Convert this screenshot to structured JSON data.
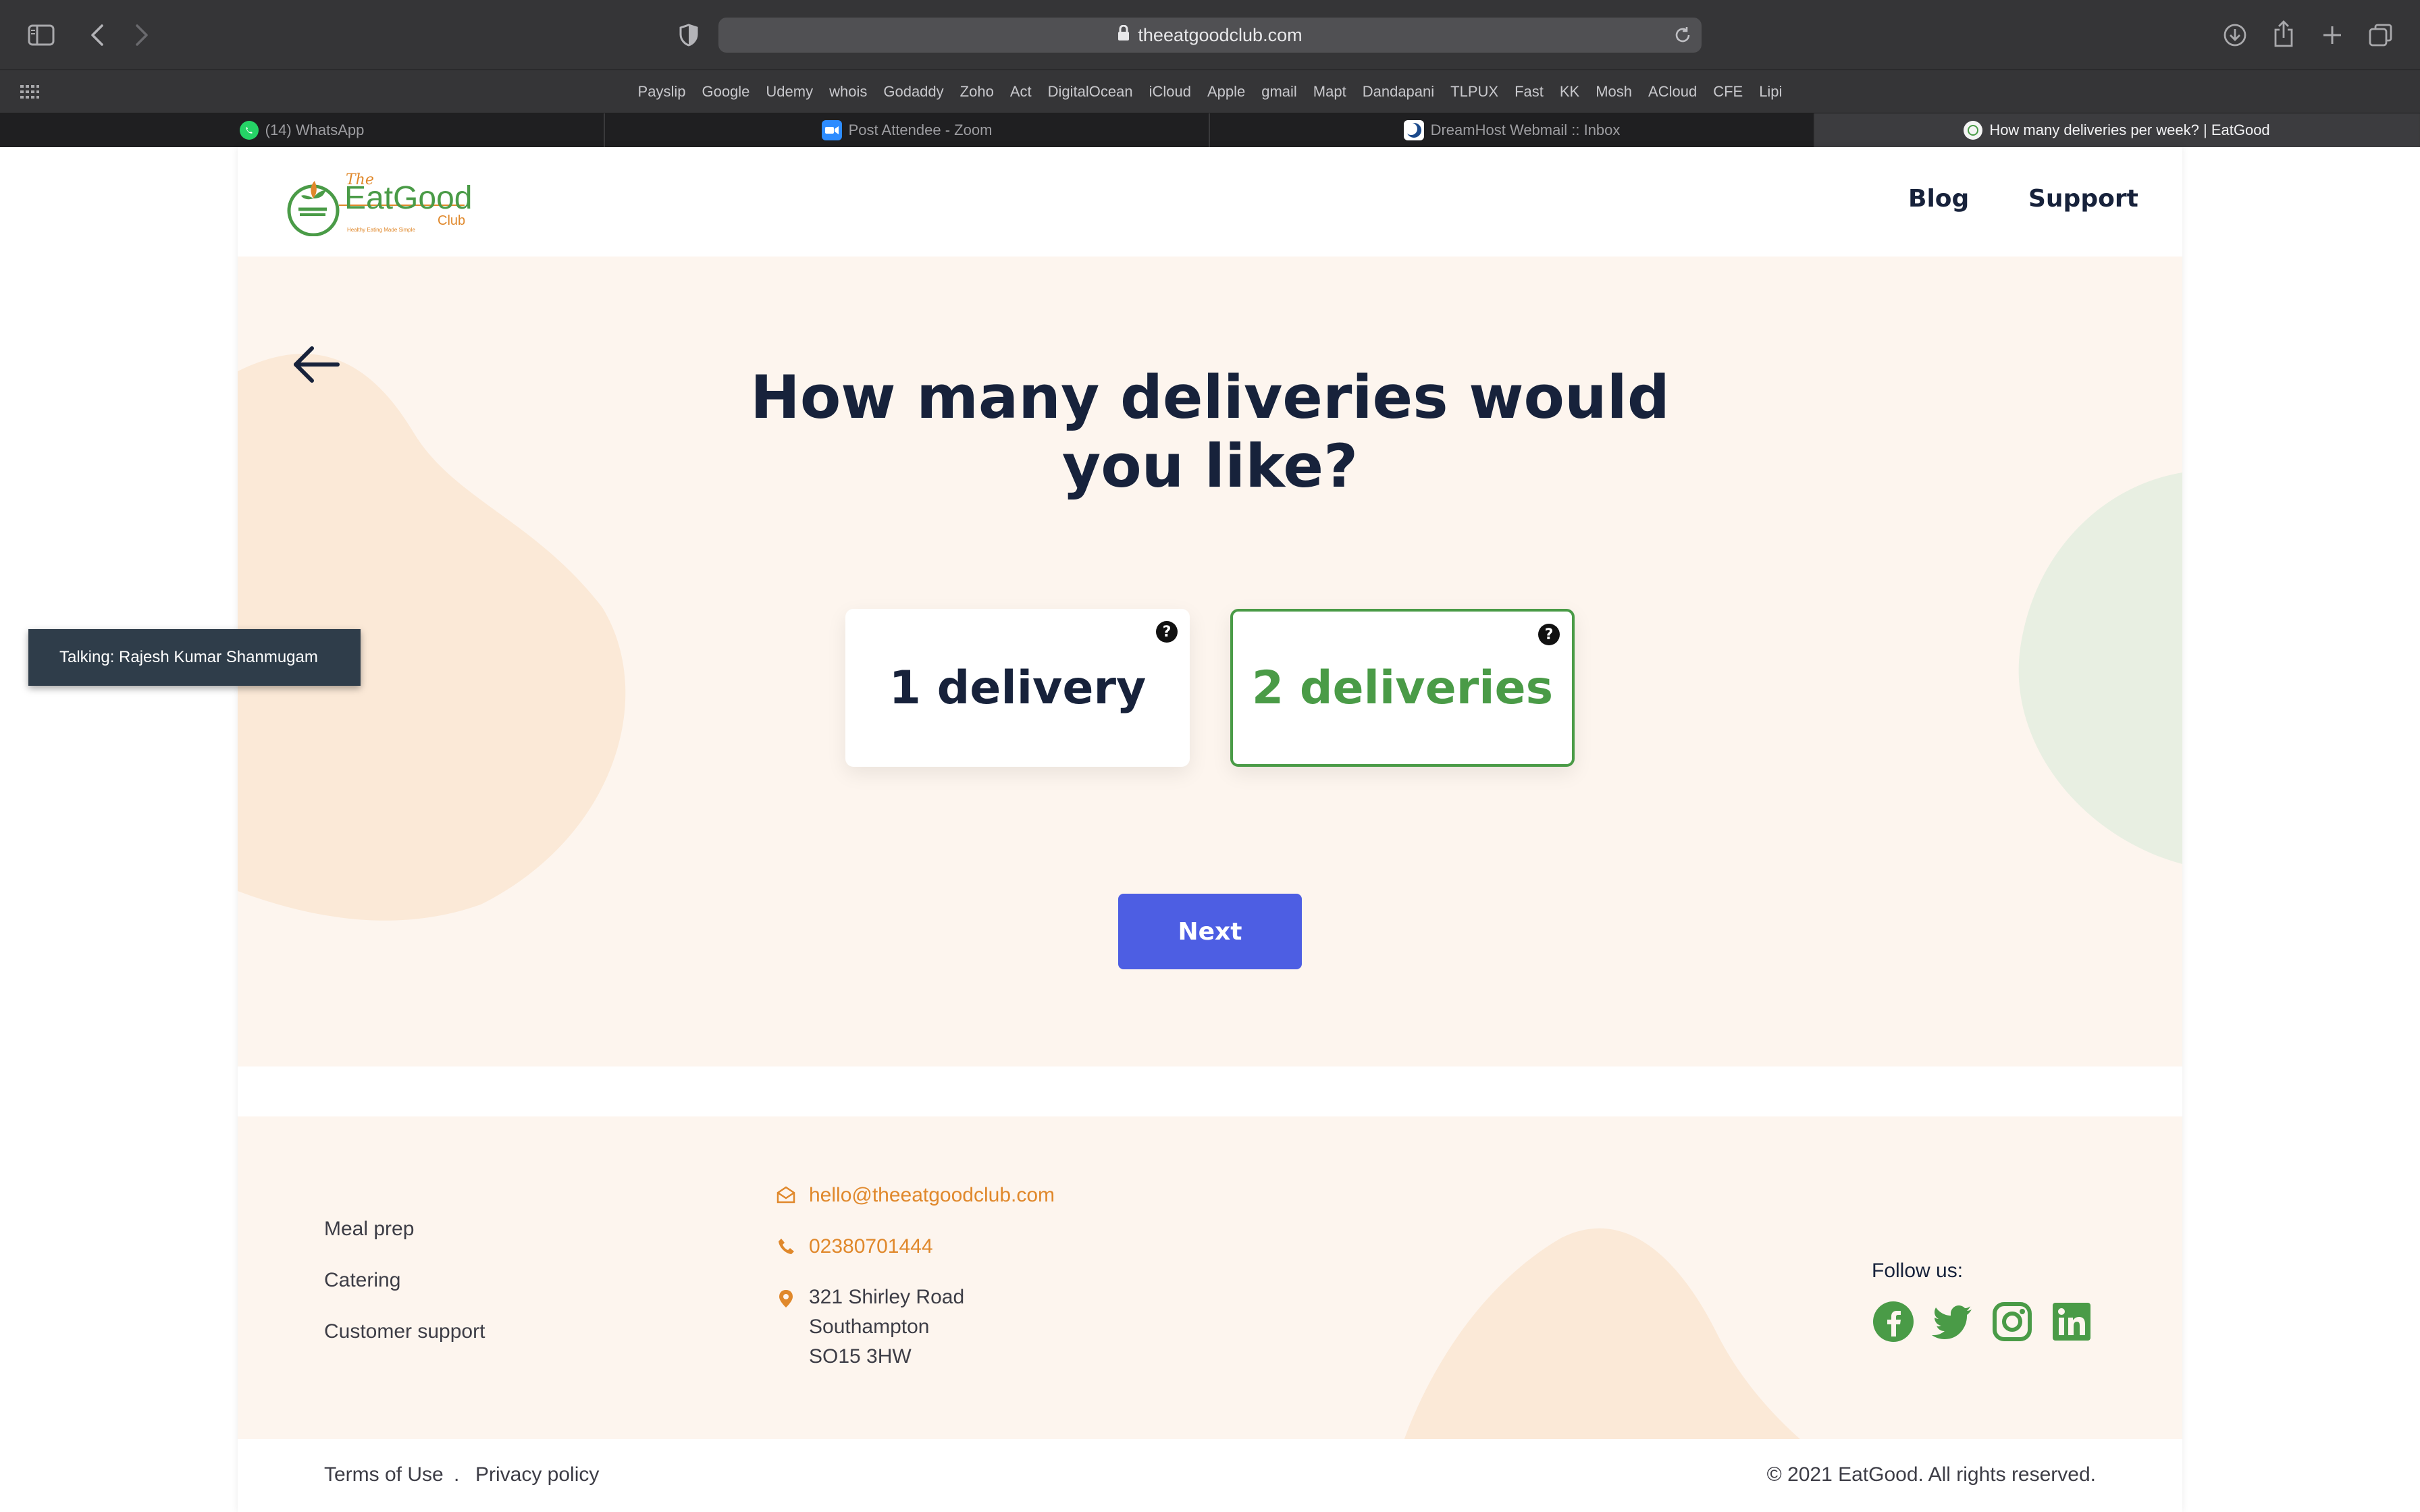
{
  "browser": {
    "url": "theeatgoodclub.com",
    "bookmarks": [
      "Payslip",
      "Google",
      "Udemy",
      "whois",
      "Godaddy",
      "Zoho",
      "Act",
      "DigitalOcean",
      "iCloud",
      "Apple",
      "gmail",
      "Mapt",
      "Dandapani",
      "TLPUX",
      "Fast",
      "KK",
      "Mosh",
      "ACloud",
      "CFE",
      "Lipi"
    ],
    "tabs": [
      {
        "label": "(14) WhatsApp",
        "icon": "whatsapp-icon"
      },
      {
        "label": "Post Attendee - Zoom",
        "icon": "zoom-icon"
      },
      {
        "label": "DreamHost Webmail :: Inbox",
        "icon": "dreamhost-icon"
      },
      {
        "label": "How many deliveries per week? | EatGood",
        "icon": "eatgood-icon",
        "active": true
      }
    ]
  },
  "header": {
    "logo": {
      "top": "The",
      "main": "EatGood",
      "sub": "Club",
      "tagline": "Healthy Eating Made Simple"
    },
    "nav": {
      "blog": "Blog",
      "support": "Support"
    }
  },
  "main": {
    "question": "How many deliveries would you like?",
    "options": [
      {
        "label": "1 delivery",
        "selected": false
      },
      {
        "label": "2 deliveries",
        "selected": true
      }
    ],
    "help_glyph": "?",
    "next_label": "Next"
  },
  "footer": {
    "links": [
      "Meal prep",
      "Catering",
      "Customer support"
    ],
    "email": "hello@theeatgoodclub.com",
    "phone": "02380701444",
    "address": [
      "321 Shirley Road",
      "Southampton",
      "SO15 3HW"
    ],
    "follow_label": "Follow us:",
    "social": [
      "facebook-icon",
      "twitter-icon",
      "instagram-icon",
      "linkedin-icon"
    ],
    "terms": "Terms of Use",
    "separator": ".",
    "privacy": "Privacy policy",
    "copyright": "© 2021 EatGood. All rights reserved."
  },
  "overlay": {
    "talking": "Talking: Rajesh Kumar Shanmugam"
  },
  "colors": {
    "navy": "#17223b",
    "green": "#4a9b47",
    "orange": "#e0882b",
    "button": "#4d5ee3",
    "cream": "#fdf5ee"
  }
}
